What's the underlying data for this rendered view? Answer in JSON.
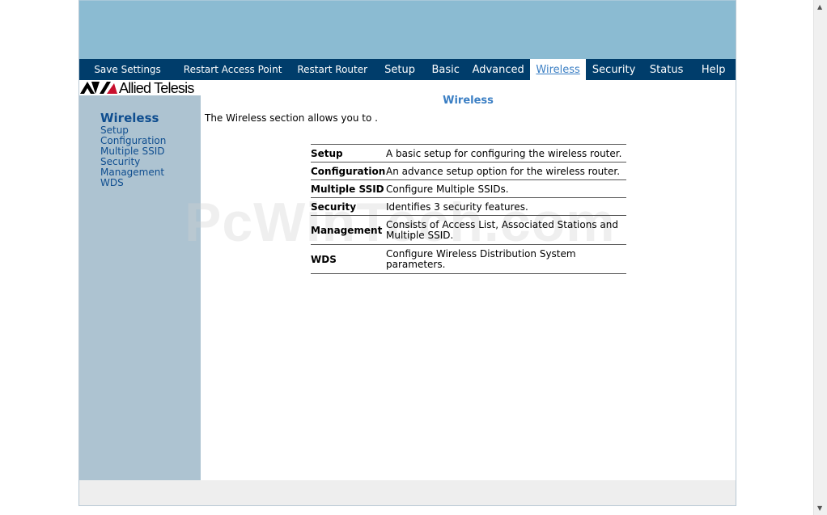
{
  "nav": [
    {
      "label": "Save Settings",
      "width": 120,
      "small": true
    },
    {
      "label": "Restart Access Point",
      "width": 142,
      "small": true
    },
    {
      "label": "Restart Router",
      "width": 106,
      "small": true
    },
    {
      "label": "Setup",
      "width": 62
    },
    {
      "label": "Basic",
      "width": 52
    },
    {
      "label": "Advanced",
      "width": 79
    },
    {
      "label": "Wireless",
      "width": 70,
      "active": true
    },
    {
      "label": "Security",
      "width": 69
    },
    {
      "label": "Status",
      "width": 62
    },
    {
      "label": "Help",
      "width": 55
    }
  ],
  "logo": {
    "text": "Allied Telesis"
  },
  "sidebar": {
    "title": "Wireless",
    "links": [
      "Setup",
      "Configuration",
      "Multiple SSID",
      "Security",
      "Management",
      "WDS"
    ]
  },
  "content": {
    "title": "Wireless",
    "intro": "The Wireless section allows you to ."
  },
  "table": [
    {
      "key": "Setup",
      "desc": "A basic setup for configuring the wireless router."
    },
    {
      "key": "Configuration",
      "desc": "An advance setup option for the wireless router."
    },
    {
      "key": "Multiple SSID",
      "desc": "Configure Multiple SSIDs."
    },
    {
      "key": "Security",
      "desc": "Identifies 3 security features."
    },
    {
      "key": "Management",
      "desc": "Consists of Access List, Associated Stations and Multiple SSID."
    },
    {
      "key": "WDS",
      "desc": "Configure Wireless Distribution System parameters."
    }
  ],
  "watermark": "PcWinTech.com"
}
